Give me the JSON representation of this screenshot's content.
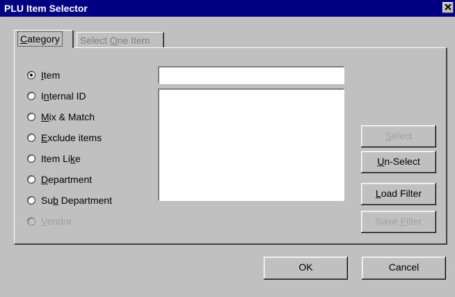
{
  "window": {
    "title": "PLU Item Selector"
  },
  "tabs": [
    {
      "pre": "",
      "accel": "C",
      "post": "ategory"
    },
    {
      "pre": "Select ",
      "accel": "O",
      "post": "ne Item"
    }
  ],
  "radios": [
    {
      "pre": "",
      "accel": "I",
      "post": "tem",
      "checked": true,
      "disabled": false
    },
    {
      "pre": "I",
      "accel": "n",
      "post": "ternal ID",
      "checked": false,
      "disabled": false
    },
    {
      "pre": "",
      "accel": "M",
      "post": "ix & Match",
      "checked": false,
      "disabled": false
    },
    {
      "pre": "",
      "accel": "E",
      "post": "xclude items",
      "checked": false,
      "disabled": false
    },
    {
      "pre": "Item Li",
      "accel": "k",
      "post": "e",
      "checked": false,
      "disabled": false
    },
    {
      "pre": "",
      "accel": "D",
      "post": "epartment",
      "checked": false,
      "disabled": false
    },
    {
      "pre": "Su",
      "accel": "b",
      "post": " Department",
      "checked": false,
      "disabled": false
    },
    {
      "pre": "",
      "accel": "V",
      "post": "endor",
      "checked": false,
      "disabled": true
    }
  ],
  "inputs": {
    "item_value": ""
  },
  "buttons": {
    "select": {
      "pre": "",
      "accel": "S",
      "post": "elect"
    },
    "unselect": {
      "pre": "",
      "accel": "U",
      "post": "n-Select"
    },
    "load": {
      "pre": "",
      "accel": "L",
      "post": "oad Filter"
    },
    "save": {
      "pre": "Save ",
      "accel": "F",
      "post": "ilter"
    },
    "ok": "OK",
    "cancel": "Cancel"
  }
}
